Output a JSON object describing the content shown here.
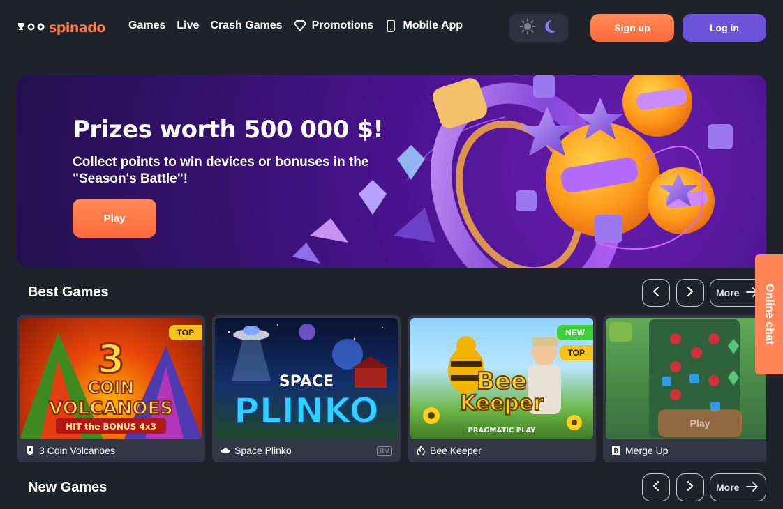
{
  "brand": {
    "name": "spinado",
    "accent": "#ff7a45"
  },
  "nav": [
    {
      "label": "Games",
      "icon": ""
    },
    {
      "label": "Live",
      "icon": ""
    },
    {
      "label": "Crash Games",
      "icon": ""
    },
    {
      "label": "Promotions",
      "icon": "diamond-icon"
    },
    {
      "label": "Mobile App",
      "icon": "phone-icon"
    }
  ],
  "theme_toggle": {
    "light_icon": "sun-icon",
    "dark_icon": "moon-icon",
    "active": "dark"
  },
  "auth": {
    "signup_label": "Sign up",
    "login_label": "Log in",
    "signup_color": "#ff7a45",
    "login_color": "#6a52d9"
  },
  "banner": {
    "title": "Prizes worth 500 000 $!",
    "subtitle": "Collect points to win devices or bonuses in the \"Season's Battle\"!",
    "play_label": "Play"
  },
  "best_games": {
    "title": "Best Games",
    "prev_icon": "chevron-left-icon",
    "next_icon": "chevron-right-icon",
    "more_label": "More",
    "cards": [
      {
        "name": "3 Coin Volcanoes",
        "provider_icon": "shield-icon",
        "badges": [
          "TOP"
        ],
        "art_title": "3 COIN VOLCANOES",
        "art_tag": "HIT the BONUS 4x3"
      },
      {
        "name": "Space Plinko",
        "provider_icon": "ufo-icon",
        "badges": [],
        "tag": "RM",
        "art_title": "SPACE PLINKO"
      },
      {
        "name": "Bee Keeper",
        "provider_icon": "flame-icon",
        "badges": [
          "NEW",
          "TOP"
        ],
        "art_title": "Bee Keeper",
        "art_tag": "PRAGMATIC PLAY"
      },
      {
        "name": "Merge Up",
        "provider_icon": "b-icon",
        "badges": [],
        "hover_label": "Play"
      }
    ]
  },
  "new_games": {
    "title": "New Games",
    "more_label": "More"
  },
  "chat": {
    "label": "Online chat"
  }
}
